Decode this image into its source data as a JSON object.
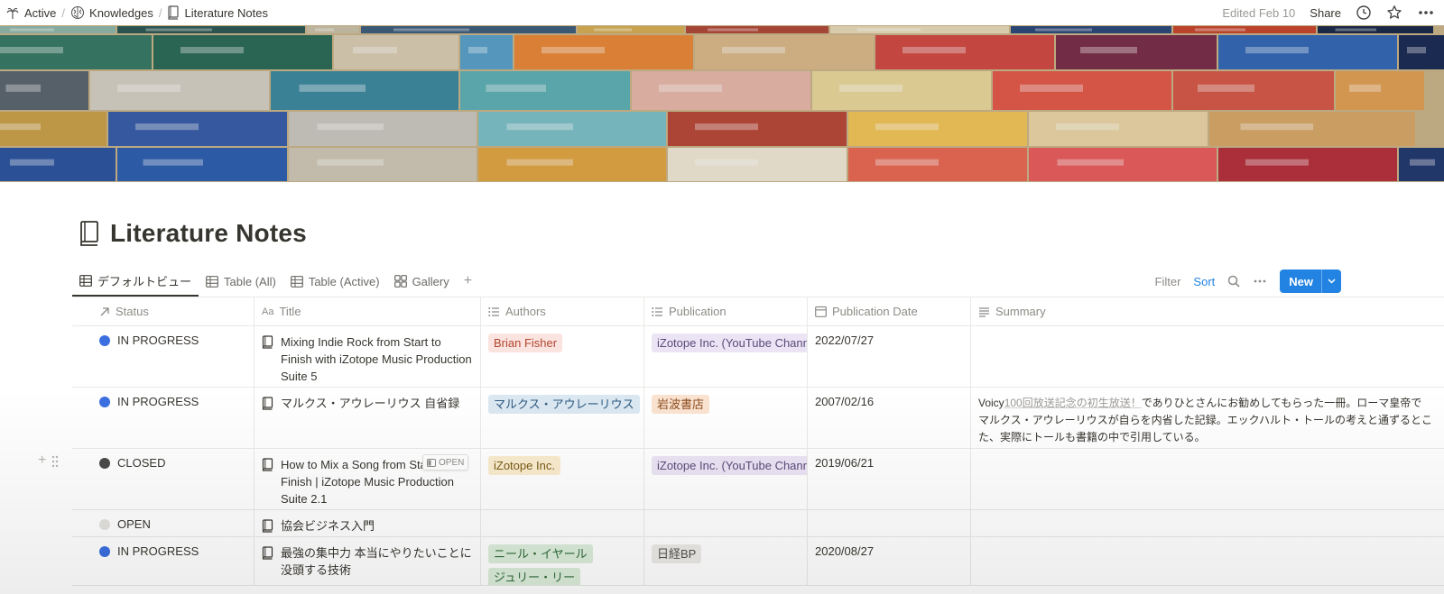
{
  "breadcrumb": {
    "items": [
      {
        "label": "Active",
        "icon": "palm-tree-icon"
      },
      {
        "label": "Knowledges",
        "icon": "brain-icon"
      },
      {
        "label": "Literature Notes",
        "icon": "book-icon"
      }
    ],
    "separator": "/"
  },
  "topbar": {
    "edited": "Edited Feb 10",
    "share": "Share",
    "icons": [
      "clock-icon",
      "star-icon",
      "more-icon"
    ]
  },
  "cover": {
    "description_icon": "books-cover-image"
  },
  "page": {
    "title": "Literature Notes",
    "icon": "book-icon"
  },
  "views": {
    "tabs": [
      {
        "label": "デフォルトビュー",
        "icon": "table-icon",
        "active": true
      },
      {
        "label": "Table (All)",
        "icon": "table-icon",
        "active": false
      },
      {
        "label": "Table (Active)",
        "icon": "table-icon",
        "active": false
      },
      {
        "label": "Gallery",
        "icon": "gallery-icon",
        "active": false
      }
    ],
    "add": "+"
  },
  "toolbar": {
    "filter": "Filter",
    "sort": "Sort",
    "new": "New",
    "accent": "#2383e2"
  },
  "table": {
    "columns": [
      {
        "label": "Status",
        "icon": "arrow-icon"
      },
      {
        "label": "Title",
        "icon": "text-icon"
      },
      {
        "label": "Authors",
        "icon": "list-icon"
      },
      {
        "label": "Publication",
        "icon": "list-icon"
      },
      {
        "label": "Publication Date",
        "icon": "calendar-icon"
      },
      {
        "label": "Summary",
        "icon": "paragraph-icon"
      }
    ],
    "text_prefix": "Aa",
    "rows": [
      {
        "status": "IN PROGRESS",
        "status_color": "#3b6fe0",
        "title": "Mixing Indie Rock from Start to Finish with iZotope Music Production Suite 5",
        "authors": [
          {
            "name": "Brian Fisher",
            "bg": "#fbe4e0",
            "fg": "#b3452f"
          }
        ],
        "publication": [
          {
            "name": "iZotope Inc. (YouTube Channel)",
            "bg": "#ebe4f5",
            "fg": "#5c4b7a"
          }
        ],
        "date": "2022/07/27",
        "summary": [
          "",
          "",
          ""
        ]
      },
      {
        "status": "IN PROGRESS",
        "status_color": "#3b6fe0",
        "title": "マルクス・アウレーリウス 自省録",
        "authors": [
          {
            "name": "マルクス・アウレーリウス",
            "bg": "#dbe8f2",
            "fg": "#2e5a80"
          }
        ],
        "publication": [
          {
            "name": "岩波書店",
            "bg": "#fae3d0",
            "fg": "#8c4b1d"
          }
        ],
        "date": "2007/02/16",
        "summary": [
          "Voicy",
          "100回放送記念の初生放送！",
          "でありひとさんにお勧めしてもらった一冊。ローマ皇帝で",
          "マルクス・アウレーリウスが自らを内省した記録。エックハルト・トールの考えと通ずるとこ",
          "た、実際にトールも書籍の中で引用している。"
        ]
      },
      {
        "status": "CLOSED",
        "status_color": "#4a4a48",
        "title": "How to Mix a Song from Start to Finish | iZotope Music Production Suite 2.1",
        "authors": [
          {
            "name": "iZotope Inc.",
            "bg": "#faeccd",
            "fg": "#7a5a17"
          }
        ],
        "publication": [
          {
            "name": "iZotope Inc. (YouTube Channel)",
            "bg": "#ebe4f5",
            "fg": "#5c4b7a"
          }
        ],
        "date": "2019/06/21",
        "summary": [
          "",
          "",
          ""
        ],
        "hover_chip": "OPEN"
      },
      {
        "status": "OPEN",
        "status_color": "#e3e2df",
        "title": "協会ビジネス入門",
        "authors": [],
        "publication": [],
        "date": "",
        "summary": [
          "",
          "",
          ""
        ]
      },
      {
        "status": "IN PROGRESS",
        "status_color": "#3b6fe0",
        "title": "最強の集中力 本当にやりたいことに没頭する技術",
        "authors": [
          {
            "name": "ニール・イヤール",
            "bg": "#dcedda",
            "fg": "#2f6b3a"
          },
          {
            "name": "ジュリー・リー",
            "bg": "#dcedda",
            "fg": "#2f6b3a"
          }
        ],
        "publication": [
          {
            "name": "日経BP",
            "bg": "#ebeae7",
            "fg": "#55534e"
          }
        ],
        "date": "2020/08/27",
        "summary": [
          "",
          "",
          ""
        ]
      }
    ]
  }
}
